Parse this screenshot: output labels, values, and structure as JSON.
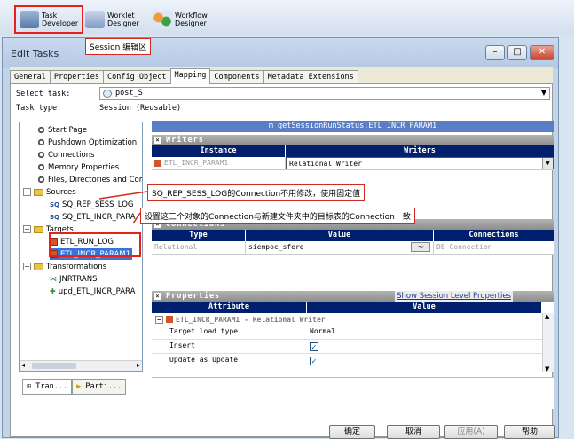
{
  "toolbar": {
    "task_developer": "Task\nDeveloper",
    "worklet_designer": "Worklet\nDesigner",
    "workflow_designer": "Workflow\nDesigner"
  },
  "window": {
    "title": "Edit Tasks"
  },
  "annotations": {
    "session_area": "Session 编辑区",
    "sources_note": "SQ_REP_SESS_LOG的Connection不用修改，使用固定值",
    "targets_note": "设置这三个对象的Connection与新建文件夹中的目标表的Connection一致"
  },
  "tabs": [
    "General",
    "Properties",
    "Config Object",
    "Mapping",
    "Components",
    "Metadata Extensions"
  ],
  "form": {
    "select_task_label": "Select task:",
    "select_task_value": "post_S",
    "task_type_label": "Task type:",
    "task_type_value": "Session (Reusable)"
  },
  "tree": {
    "items": [
      "Start Page",
      "Pushdown Optimization",
      "Connections",
      "Memory Properties",
      "Files, Directories and Com"
    ],
    "sources_label": "Sources",
    "sources": [
      "SQ_REP_SESS_LOG",
      "SQ_ETL_INCR_PARA"
    ],
    "targets_label": "Targets",
    "targets": [
      "ETL_RUN_LOG",
      "ETL_INCR_PARAM1"
    ],
    "transformations_label": "Transformations",
    "transformations": [
      "JNRTRANS",
      "upd_ETL_INCR_PARA"
    ]
  },
  "bottom_tabs": [
    "Tran...",
    "Parti..."
  ],
  "right": {
    "mapping_title": "m_getSessionRunStatus.ETL_INCR_PARAM1",
    "writers": {
      "title": "Writers",
      "col_instance": "Instance",
      "col_writers": "Writers",
      "row_instance": "ETL_INCR_PARAM1",
      "row_writer": "Relational Writer"
    },
    "connections": {
      "title": "Connections",
      "col_type": "Type",
      "col_value": "Value",
      "col_conn": "Connections",
      "row_type": "Relational",
      "row_value": "siempoc_sfere",
      "row_conn": "DB Connection"
    },
    "properties": {
      "title": "Properties",
      "show_link": "Show Session Level Properties",
      "col_attr": "Attribute",
      "col_value": "Value",
      "group": "ETL_INCR_PARAM1 - Relational Writer",
      "rows": [
        {
          "attr": "Target load type",
          "value": "Normal"
        },
        {
          "attr": "Insert",
          "value": "✓"
        },
        {
          "attr": "Update as Update",
          "value": "✓"
        }
      ]
    }
  },
  "buttons": {
    "ok": "确定",
    "cancel": "取消",
    "apply": "应用(A)",
    "help": "帮助"
  }
}
